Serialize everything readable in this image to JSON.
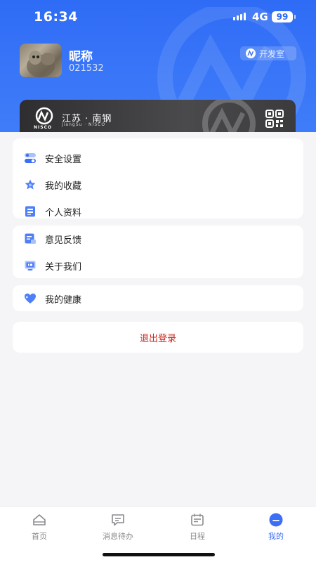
{
  "status_bar": {
    "time": "16:34",
    "network": "4G",
    "battery": "99"
  },
  "profile": {
    "nickname": "昵称",
    "user_id": "021532",
    "env_badge": "开发室"
  },
  "company_card": {
    "logo_text": "NISCO",
    "title": "江苏 · 南钢",
    "subtitle": "JiangSu · NISCO"
  },
  "menu_groups": [
    {
      "items": [
        {
          "label": "安全设置",
          "icon": "toggle-icon"
        },
        {
          "label": "我的收藏",
          "icon": "star-icon"
        },
        {
          "label": "个人资料",
          "icon": "profile-doc-icon"
        }
      ]
    },
    {
      "items": [
        {
          "label": "意见反馈",
          "icon": "feedback-icon"
        },
        {
          "label": "关于我们",
          "icon": "about-icon"
        }
      ]
    },
    {
      "items": [
        {
          "label": "我的健康",
          "icon": "heart-icon"
        }
      ]
    }
  ],
  "logout_label": "退出登录",
  "tabs": [
    {
      "label": "首页",
      "icon": "home-icon",
      "active": false
    },
    {
      "label": "消息待办",
      "icon": "message-icon",
      "active": false
    },
    {
      "label": "日程",
      "icon": "calendar-icon",
      "active": false
    },
    {
      "label": "我的",
      "icon": "user-icon",
      "active": true
    }
  ],
  "colors": {
    "primary": "#3b6ff5",
    "header_blue": "#2f6cf6",
    "logout_red": "#c8281e",
    "card_dark": "#3a3a3c"
  }
}
